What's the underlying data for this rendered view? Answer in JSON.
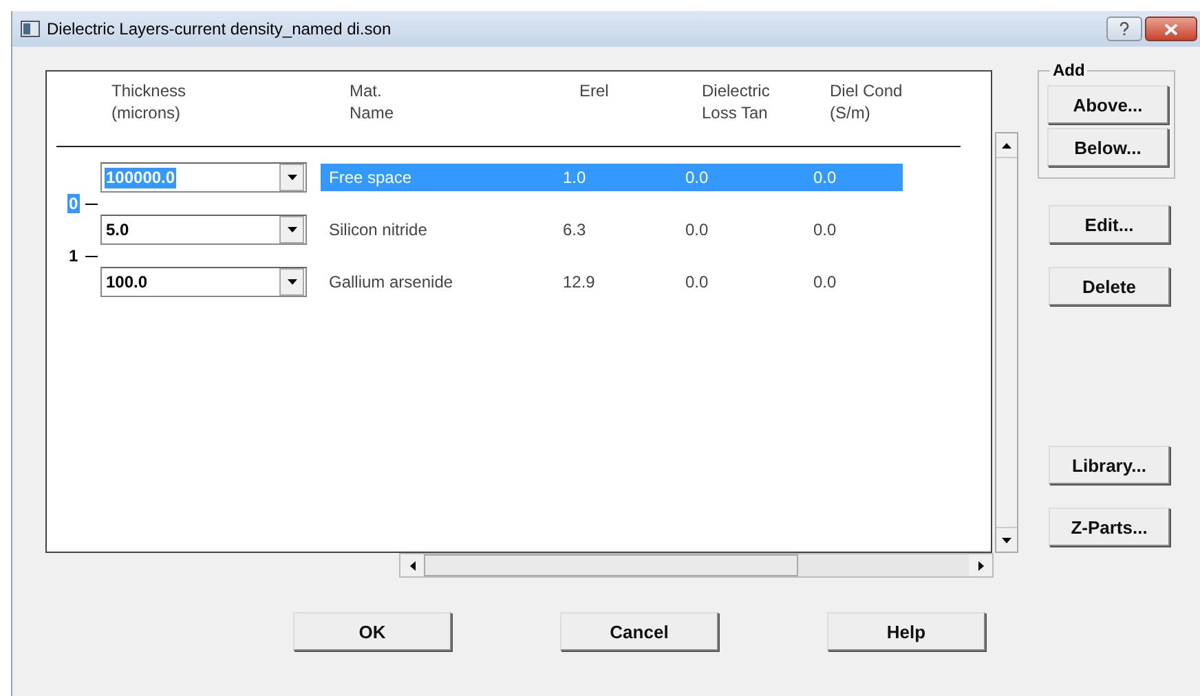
{
  "window": {
    "title": "Dielectric Layers-current density_named di.son"
  },
  "table": {
    "columns": [
      "Thickness\n(microns)",
      "Mat.\nName",
      "Erel",
      "Dielectric\nLoss Tan",
      "Diel Cond\n(S/m)"
    ],
    "layers": [
      {
        "thickness": "100000.0",
        "name": "Free space",
        "erel": "1.0",
        "loss_tan": "0.0",
        "cond": "0.0",
        "selected": true
      },
      {
        "thickness": "5.0",
        "name": "Silicon nitride",
        "erel": "6.3",
        "loss_tan": "0.0",
        "cond": "0.0",
        "selected": false
      },
      {
        "thickness": "100.0",
        "name": "Gallium arsenide",
        "erel": "12.9",
        "loss_tan": "0.0",
        "cond": "0.0",
        "selected": false
      }
    ],
    "interfaces": [
      {
        "label": "0",
        "selected": true
      },
      {
        "label": "1",
        "selected": false
      }
    ]
  },
  "add_group": {
    "title": "Add",
    "buttons": [
      "Above...",
      "Below..."
    ]
  },
  "side_buttons": [
    "Edit...",
    "Delete",
    "Library...",
    "Z-Parts..."
  ],
  "buttons": [
    "OK",
    "Cancel",
    "Help"
  ]
}
